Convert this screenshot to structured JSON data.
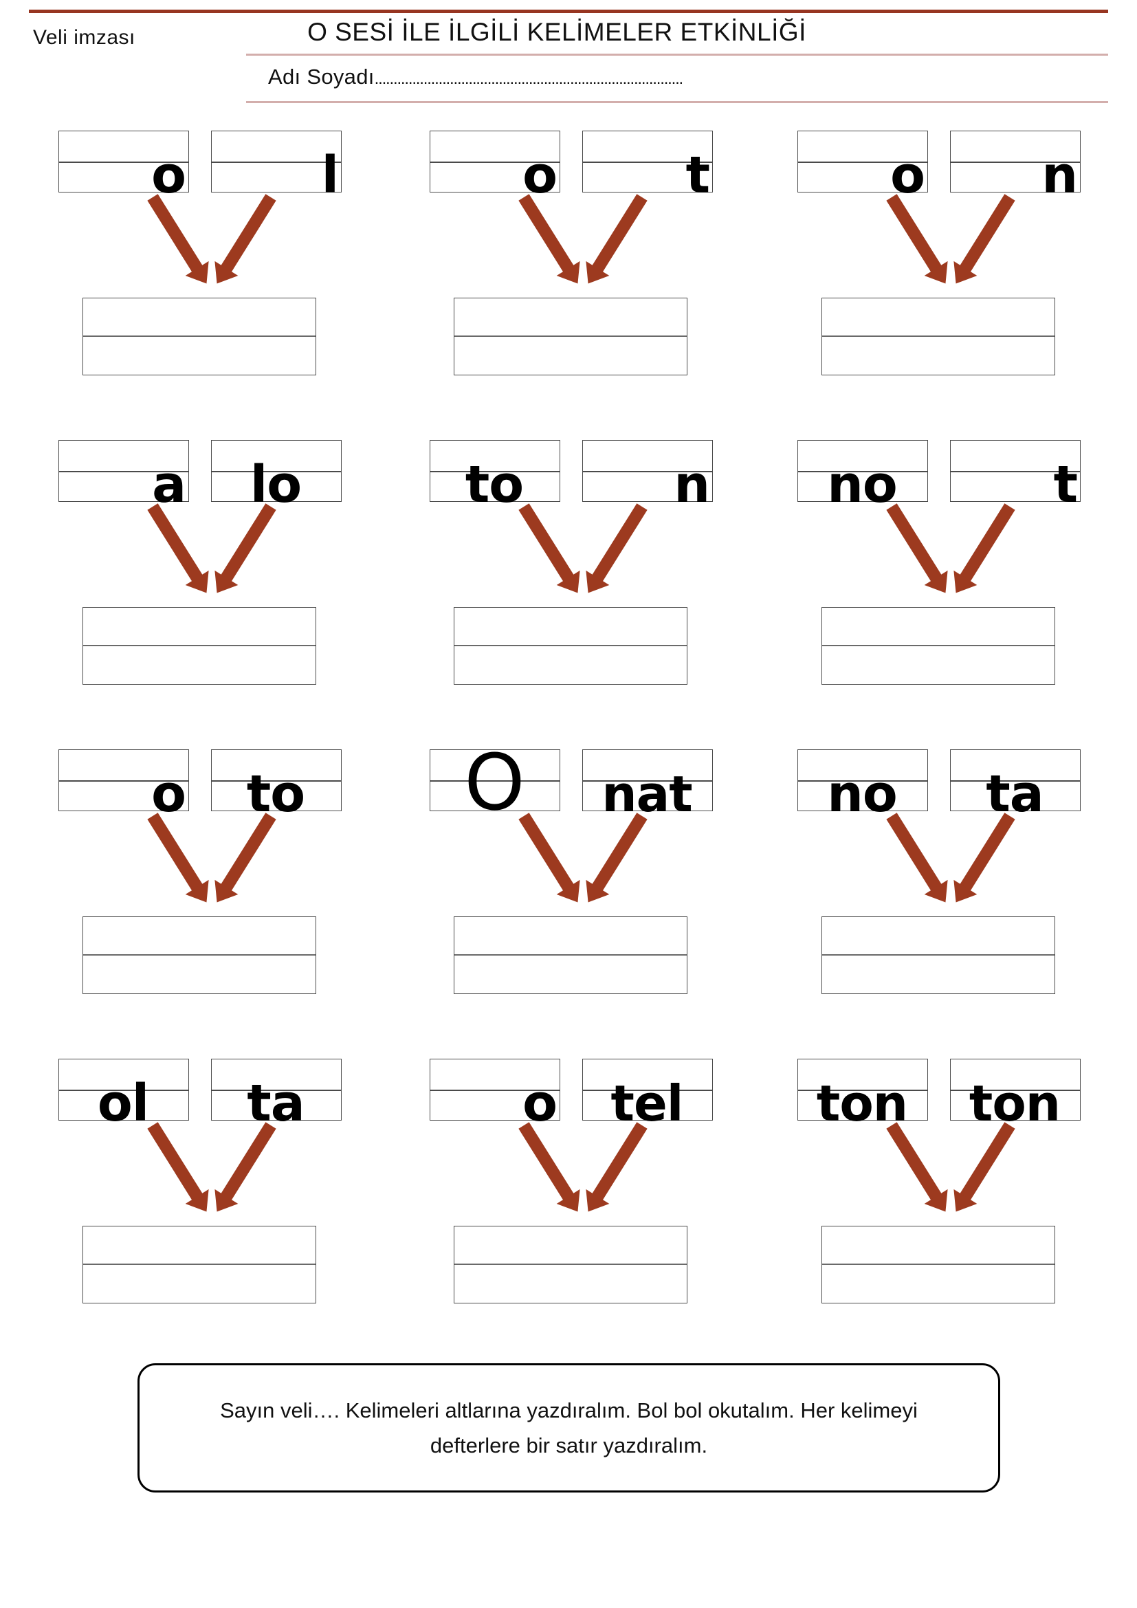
{
  "header": {
    "parent_signature_label": "Veli imzası",
    "title": "O SESİ İLE İLGİLİ KELİMELER ETKİNLİĞİ",
    "name_label": "Adı Soyadı",
    "name_dots": "..................................................................................",
    "rule_color_top": "#973521",
    "rule_color_thin": "#d3aeac"
  },
  "arrow_color": "#9d3a1f",
  "box_border_color": "#4a4a4a",
  "exercises": [
    {
      "row": 1,
      "groups": [
        {
          "left_syllable": "o",
          "right_syllable": "l",
          "answer": ""
        },
        {
          "left_syllable": "o",
          "right_syllable": "t",
          "answer": ""
        },
        {
          "left_syllable": "o",
          "right_syllable": "n",
          "answer": ""
        }
      ]
    },
    {
      "row": 2,
      "groups": [
        {
          "left_syllable": "a",
          "right_syllable": "lo",
          "answer": ""
        },
        {
          "left_syllable": "to",
          "right_syllable": "n",
          "answer": ""
        },
        {
          "left_syllable": "no",
          "right_syllable": "t",
          "answer": ""
        }
      ]
    },
    {
      "row": 3,
      "groups": [
        {
          "left_syllable": "o",
          "right_syllable": "to",
          "answer": ""
        },
        {
          "left_syllable": "O",
          "right_syllable": "nat",
          "answer": ""
        },
        {
          "left_syllable": "no",
          "right_syllable": "ta",
          "answer": ""
        }
      ]
    },
    {
      "row": 4,
      "groups": [
        {
          "left_syllable": "ol",
          "right_syllable": "ta",
          "answer": ""
        },
        {
          "left_syllable": "o",
          "right_syllable": "tel",
          "answer": ""
        },
        {
          "left_syllable": "ton",
          "right_syllable": "ton",
          "answer": ""
        }
      ]
    }
  ],
  "note": {
    "text": "Sayın veli…. Kelimeleri altlarına yazdıralım. Bol bol okutalım. Her kelimeyi defterlere bir satır yazdıralım."
  }
}
